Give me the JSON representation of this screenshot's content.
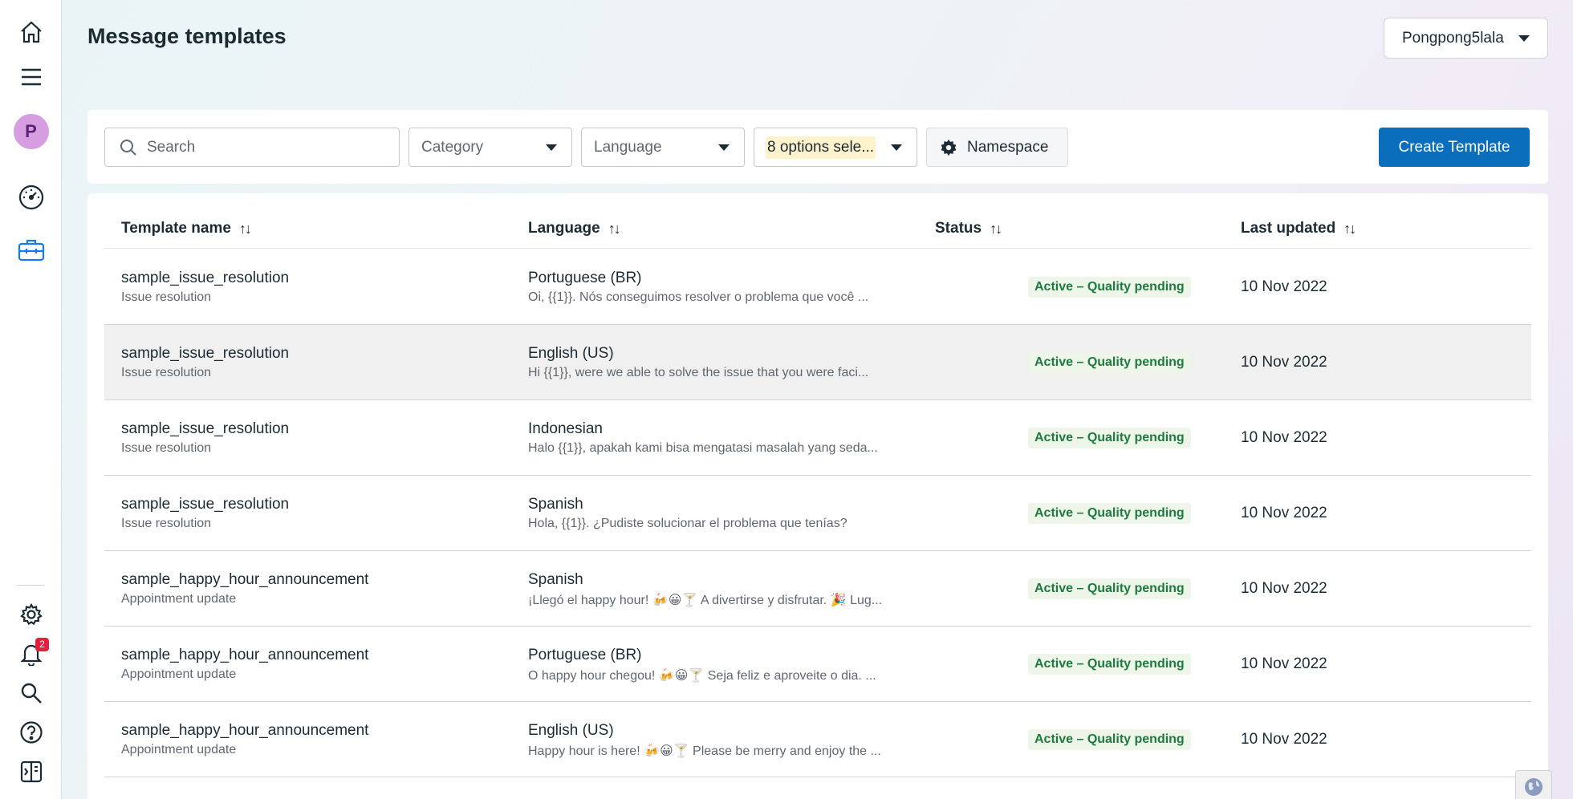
{
  "page": {
    "title": "Message templates"
  },
  "account": {
    "name": "Pongpong5lala"
  },
  "sidebar": {
    "avatar_letter": "P",
    "notification_count": "2",
    "icons": [
      "home-icon",
      "menu-icon",
      "dashboard-gauge-icon",
      "briefcase-icon",
      "gear-icon",
      "bell-icon",
      "search-icon",
      "help-icon",
      "panel-toggle-icon"
    ]
  },
  "filters": {
    "search_placeholder": "Search",
    "category": "Category",
    "language": "Language",
    "options": "8 options sele...",
    "namespace": "Namespace",
    "create": "Create Template"
  },
  "table": {
    "columns": [
      "Template name",
      "Language",
      "Status",
      "Last updated"
    ],
    "sort_icon": "↑↓",
    "rows": [
      {
        "name": "sample_issue_resolution",
        "category": "Issue resolution",
        "language": "Portuguese (BR)",
        "preview": "Oi, {{1}}. Nós conseguimos resolver o problema que você ...",
        "status": "Active – Quality pending",
        "updated": "10 Nov 2022"
      },
      {
        "name": "sample_issue_resolution",
        "category": "Issue resolution",
        "language": "English (US)",
        "preview": "Hi {{1}}, were we able to solve the issue that you were faci...",
        "status": "Active – Quality pending",
        "updated": "10 Nov 2022"
      },
      {
        "name": "sample_issue_resolution",
        "category": "Issue resolution",
        "language": "Indonesian",
        "preview": "Halo {{1}}, apakah kami bisa mengatasi masalah yang seda...",
        "status": "Active – Quality pending",
        "updated": "10 Nov 2022"
      },
      {
        "name": "sample_issue_resolution",
        "category": "Issue resolution",
        "language": "Spanish",
        "preview": "Hola, {{1}}. ¿Pudiste solucionar el problema que tenías?",
        "status": "Active – Quality pending",
        "updated": "10 Nov 2022"
      },
      {
        "name": "sample_happy_hour_announcement",
        "category": "Appointment update",
        "language": "Spanish",
        "preview": "¡Llegó el happy hour! 🍻😀🍸 A divertirse y disfrutar. 🎉 Lug...",
        "status": "Active – Quality pending",
        "updated": "10 Nov 2022"
      },
      {
        "name": "sample_happy_hour_announcement",
        "category": "Appointment update",
        "language": "Portuguese (BR)",
        "preview": "O happy hour chegou! 🍻😀🍸 Seja feliz e aproveite o dia. ...",
        "status": "Active – Quality pending",
        "updated": "10 Nov 2022"
      },
      {
        "name": "sample_happy_hour_announcement",
        "category": "Appointment update",
        "language": "English (US)",
        "preview": "Happy hour is here! 🍻😀🍸 Please be merry and enjoy the ...",
        "status": "Active – Quality pending",
        "updated": "10 Nov 2022"
      }
    ]
  },
  "colors": {
    "primary": "#0a6ebd",
    "status_text": "#1d7b3f",
    "status_bg": "#eef5e9",
    "avatar": "#d69ee0"
  }
}
